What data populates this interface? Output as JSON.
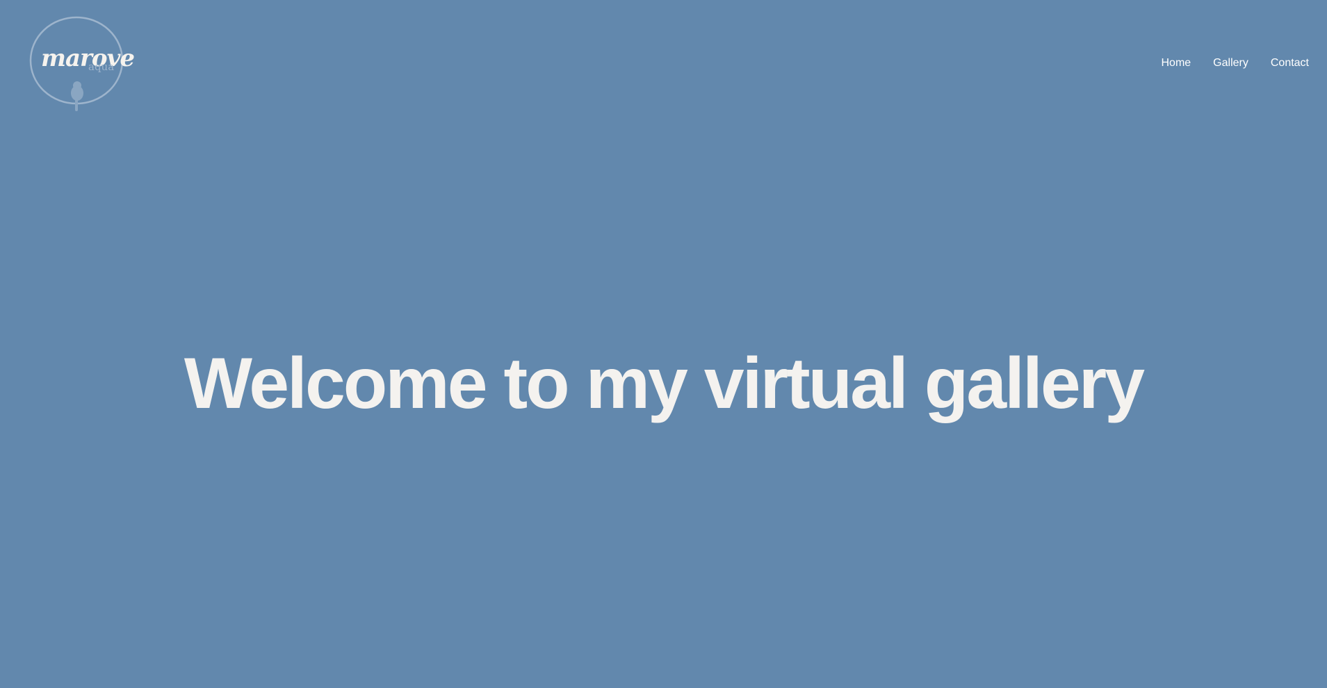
{
  "logo": {
    "word": "marove",
    "sub": "aqua",
    "icon": "bird-icon"
  },
  "nav": [
    {
      "label": "Home"
    },
    {
      "label": "Gallery"
    },
    {
      "label": "Contact"
    }
  ],
  "hero": {
    "title": "Welcome to my virtual gallery"
  },
  "colors": {
    "background": "#6288ad",
    "text": "#f4f2ef",
    "logo_ring": "#9db4cc"
  }
}
